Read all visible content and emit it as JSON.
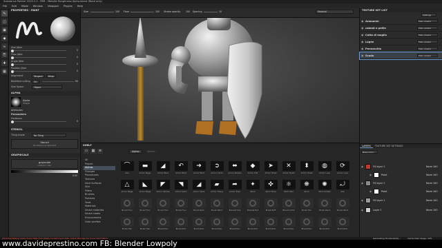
{
  "window": {
    "title": "Substance Painter 2019.2.2 - PBR - Metallic Roughness Alpha-blend (Read only)"
  },
  "menu": [
    "File",
    "Edit",
    "Mode",
    "Window",
    "Viewport",
    "Plugins",
    "Help"
  ],
  "properties": {
    "header": "PROPERTIES - PAINT",
    "sliders": [
      {
        "label": "Size Jitter",
        "value": "0"
      },
      {
        "label": "Flow Jitter",
        "value": "0"
      },
      {
        "label": "Angle Jitter",
        "value": "0"
      },
      {
        "label": "Position Jitter",
        "value": "0"
      }
    ],
    "alignment": {
      "label": "Alignment",
      "a": "Tangent",
      "b": "Wrap"
    },
    "backface": {
      "label": "Backface culling",
      "a": "On",
      "value": "90"
    },
    "sizespace": {
      "label": "Size Space",
      "a": "Object"
    },
    "alpha_header": "ALPHA",
    "alpha_name": "Alpha",
    "alpha_sub": "Shape",
    "attributes": "Attributes",
    "parameters": "Parameters",
    "hardness": {
      "label": "Hardness",
      "value": "0"
    },
    "stencil_header": "STENCIL",
    "tiling": {
      "label": "Tiling mode",
      "a": "No Tiling"
    },
    "stencil_name": "Stencil",
    "stencil_sub": "No Resource Selected",
    "graphical_header": "GRAPHICALE",
    "gray_name": "grayscale",
    "gray_sub": "uniform color",
    "gray_value": "0.02"
  },
  "viewtop": {
    "size_label": "Size",
    "size_val": "100",
    "flow_label": "Flow",
    "flow_val": "100",
    "stroke_label": "Stroke opacity",
    "stroke_val": "100",
    "spacing_label": "Spacing",
    "spacing_val": "10",
    "material": "Material"
  },
  "texturesets": {
    "header": "TEXTURE SET LIST",
    "settings": "Settings",
    "items": [
      {
        "name": "Armoarsh",
        "shader": "Main shader"
      },
      {
        "name": "cabeat e peille",
        "shader": "Main shader"
      },
      {
        "name": "Cotta di maglia",
        "shader": "Main shader"
      },
      {
        "name": "Logen",
        "shader": "Main shader"
      },
      {
        "name": "Pennacchio",
        "shader": "Main shader"
      },
      {
        "name": "Scudo",
        "shader": "Main shader"
      }
    ]
  },
  "shelf": {
    "header": "SHELF",
    "filter": "Alphas",
    "search": "Search...",
    "categories": [
      "All",
      "Project",
      "Alphas",
      "Grunges",
      "Procedurals",
      "Textures",
      "Hard Surfaces",
      "Skin",
      "Filters",
      "Brushes",
      "Particles",
      "Tools",
      "Materials",
      "Smart materials",
      "Smart masks",
      "Environments",
      "Color profiles"
    ],
    "active_category": "Alphas",
    "row1": [
      "arcs",
      "Armor Nega",
      "Armor Bent",
      "Armor Bent",
      "Armor Bent",
      "Armor Circle",
      "Armor Double",
      "Armor Flat",
      "Armor Head",
      "Armor Head",
      "Armor Head",
      "Armor Loop",
      "Armor Loop"
    ],
    "row1_icons": [
      "⌒",
      "▬",
      "◢",
      "↶",
      "➜",
      "➲",
      "⬌",
      "◆",
      "➤",
      "✕",
      "⬍",
      "◍",
      "⟳"
    ],
    "row2": [
      "Armor Nega",
      "Armor Nega",
      "Armor Simple",
      "Armor Spira",
      "Armor Spira",
      "Armor Triang",
      "Armor Trian",
      "Atom",
      "Atom Simp",
      "Atom Star",
      "Atom",
      "Atom Simple",
      "axe"
    ],
    "row2_icons": [
      "△",
      "◣",
      "◤",
      "◥",
      "◢",
      "▰",
      "➦",
      "✦",
      "✜",
      "⚛",
      "❋",
      "✺",
      "⤾"
    ],
    "row3": [
      "Brush Fren",
      "Brush Fren",
      "Brush Fren",
      "Brush Fren",
      "Brush Ram",
      "Brush Paint",
      "Bracket Sha",
      "Bracket Buf",
      "Brush Buff",
      "Brush Comb",
      "Brush Fen",
      "Brush Paint",
      "Brush Paint"
    ],
    "row4": [
      "Brush Han",
      "Brush Han",
      "Brush Pain",
      "Brush Pain",
      "Brush Pain",
      "Brush Pain",
      "Brush Pain",
      "Brush Pain",
      "Brush Pain",
      "Brush Pain",
      "Brush Pain",
      "Brush Pain",
      "Brush Pain"
    ]
  },
  "layers": {
    "tab1": "LAYERS",
    "tab2": "TEXTURE SET SETTINGS",
    "channel": "Base Color",
    "items": [
      {
        "name": "Fill layer 1",
        "blend": "Norm",
        "opacity": "100",
        "color": "#c0392b"
      },
      {
        "name": "Paint",
        "blend": "Norm",
        "opacity": "100",
        "color": "#ffffff"
      },
      {
        "name": "Fill layer 1",
        "blend": "Norm",
        "opacity": "100",
        "color": "#8a8a8a"
      },
      {
        "name": "Paint",
        "blend": "Norm",
        "opacity": "100",
        "color": "#ffffff"
      },
      {
        "name": "Fill layer 1",
        "blend": "Norm",
        "opacity": "100",
        "color": "#9a9a9a"
      },
      {
        "name": "Layer 1",
        "blend": "Norm",
        "opacity": "100",
        "color": "#d0d0d0"
      }
    ]
  },
  "status": {
    "warning": "[Sharing] Baking Value (Color Map from Mesh) Invalid input data. Check the logs for more information.",
    "computing": "Generating thumbnail(0)...",
    "cache": "Cache Disk Usage: 10%"
  },
  "footer": {
    "text": "www.davideprestino.com   FB: Blender Lowpoly"
  },
  "colors": {
    "accent": "#6c9ad2",
    "bg": "#2b2b2b",
    "footer": "#000000"
  }
}
